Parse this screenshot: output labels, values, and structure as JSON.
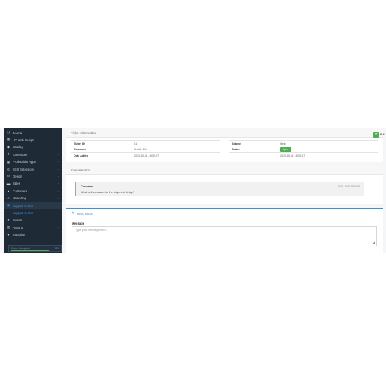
{
  "sidebar": {
    "items": [
      {
        "icon": "book-icon",
        "glyph": "❑",
        "label": "Journal",
        "chevron": "›"
      },
      {
        "icon": "wordpress-icon",
        "glyph": "▦",
        "label": "HP Web Design",
        "chevron": "›"
      },
      {
        "icon": "tag-icon",
        "glyph": "⬢",
        "label": "Catalog",
        "chevron": "›"
      },
      {
        "icon": "puzzle-icon",
        "glyph": "✚",
        "label": "Extensions",
        "chevron": "›"
      },
      {
        "icon": "grid-icon",
        "glyph": "▦",
        "label": "Productivity Apps",
        "chevron": "›"
      },
      {
        "icon": "google-icon",
        "glyph": "G",
        "label": "SEO Extensions",
        "chevron": "›"
      },
      {
        "icon": "monitor-icon",
        "glyph": "▭",
        "label": "Design",
        "chevron": "›"
      },
      {
        "icon": "cart-icon",
        "glyph": "▬",
        "label": "Sales",
        "chevron": "›"
      },
      {
        "icon": "user-icon",
        "glyph": "●",
        "label": "Customers",
        "chevron": "›"
      },
      {
        "icon": "share-icon",
        "glyph": "⋖",
        "label": "Marketing",
        "chevron": "›"
      },
      {
        "icon": "support-icon",
        "glyph": "▣",
        "label": "Support Center",
        "chevron": "⌄"
      },
      {
        "icon": "dash-icon",
        "glyph": "-",
        "label": "Support Center",
        "chevron": ""
      },
      {
        "icon": "gear-icon",
        "glyph": "✹",
        "label": "System",
        "chevron": "›"
      },
      {
        "icon": "bar-chart-icon",
        "glyph": "▥",
        "label": "Reports",
        "chevron": "›"
      },
      {
        "icon": "star-icon",
        "glyph": "★",
        "label": "Trustpilot",
        "chevron": ""
      }
    ],
    "progress": {
      "label": "Orders Completed",
      "value": "78%",
      "fraction": 0.78
    }
  },
  "ticket": {
    "header": "Ticket Information",
    "left_rows": [
      {
        "key": "Ticket ID",
        "value": "#1"
      },
      {
        "key": "Customer",
        "value": "Shaikh Efu"
      },
      {
        "key": "Date Added",
        "value": "2025-10-08 18:30:07"
      }
    ],
    "right_rows": [
      {
        "key": "Subject",
        "value": "Hello"
      },
      {
        "key": "Status",
        "value": "Open"
      },
      {
        "key": "",
        "value": "2025-10-08 18:30:07"
      }
    ]
  },
  "conversation": {
    "header": "Conversation",
    "message": {
      "author": "Customer",
      "time": "2025-10-08 18:30:07",
      "text": "What is the reason for the shipment delay?"
    }
  },
  "reply": {
    "tab_label": "Send Reply",
    "message_label": "Message",
    "placeholder": "Type your message here..."
  },
  "ext": {
    "label": "6.4"
  },
  "colors": {
    "sidebar_bg": "#1e2a36",
    "accent": "#3d8fd6",
    "status_green": "#4caf50"
  }
}
